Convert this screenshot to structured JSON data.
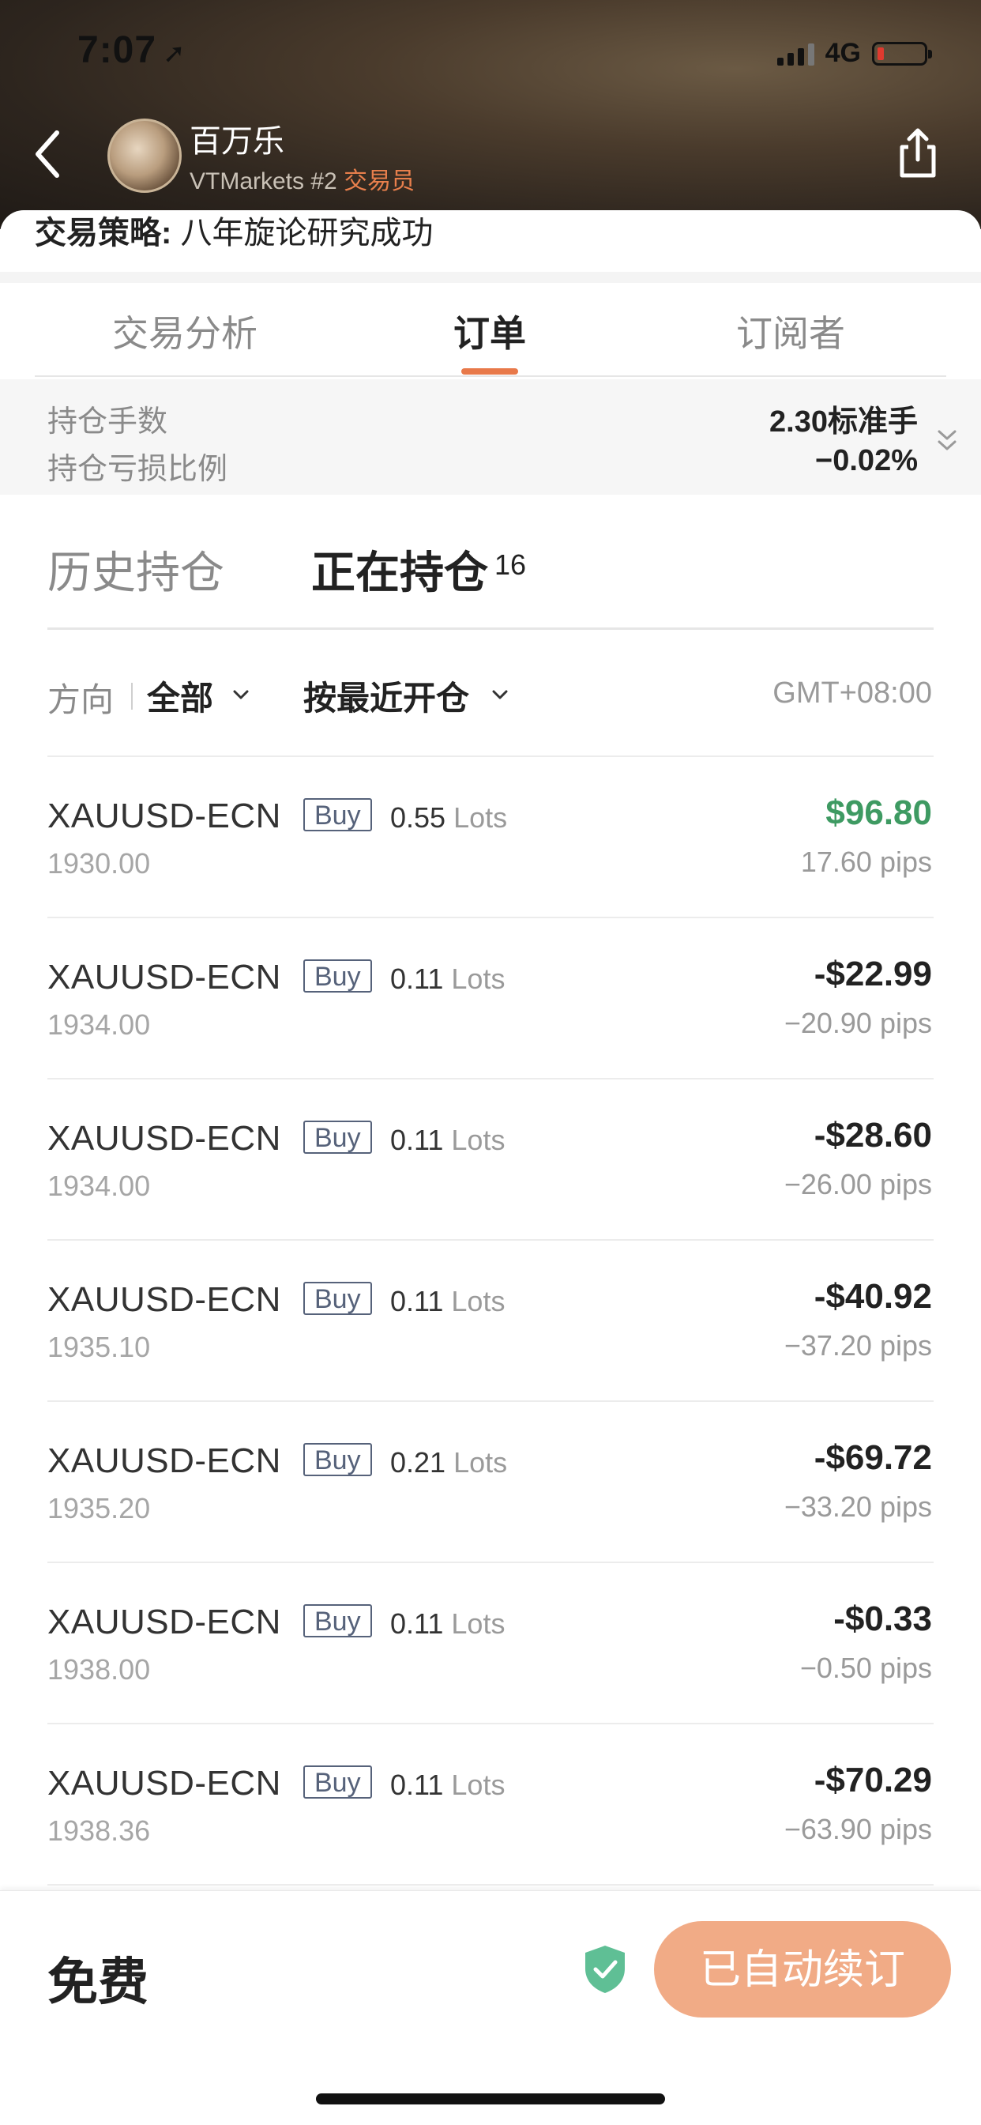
{
  "status_bar": {
    "time": "7:07",
    "network": "4G"
  },
  "header": {
    "trader_name": "百万乐",
    "broker_rank": "VTMarkets #2",
    "role": "交易员"
  },
  "strategy": {
    "label": "交易策略:",
    "text": "八年旋论研究成功"
  },
  "tabs": [
    {
      "label": "交易分析",
      "active": false
    },
    {
      "label": "订单",
      "active": true
    },
    {
      "label": "订阅者",
      "active": false
    }
  ],
  "summary": {
    "lots_label": "持仓手数",
    "lots_value": "2.30标准手",
    "pnl_ratio_label": "持仓亏损比例",
    "pnl_ratio_value": "−0.02%"
  },
  "position_tabs": {
    "history_label": "历史持仓",
    "open_label": "正在持仓",
    "open_count": "16"
  },
  "filters": {
    "direction_label": "方向",
    "direction_value": "全部",
    "sort_value": "按最近开仓",
    "timezone": "GMT+08:00"
  },
  "orders": [
    {
      "symbol": "XAUUSD-ECN",
      "side": "Buy",
      "lots": "0.55",
      "lots_unit": "Lots",
      "open_price": "1930.00",
      "pnl": "$96.80",
      "pips": "17.60 pips",
      "positive": true
    },
    {
      "symbol": "XAUUSD-ECN",
      "side": "Buy",
      "lots": "0.11",
      "lots_unit": "Lots",
      "open_price": "1934.00",
      "pnl": "-$22.99",
      "pips": "−20.90 pips",
      "positive": false
    },
    {
      "symbol": "XAUUSD-ECN",
      "side": "Buy",
      "lots": "0.11",
      "lots_unit": "Lots",
      "open_price": "1934.00",
      "pnl": "-$28.60",
      "pips": "−26.00 pips",
      "positive": false
    },
    {
      "symbol": "XAUUSD-ECN",
      "side": "Buy",
      "lots": "0.11",
      "lots_unit": "Lots",
      "open_price": "1935.10",
      "pnl": "-$40.92",
      "pips": "−37.20 pips",
      "positive": false
    },
    {
      "symbol": "XAUUSD-ECN",
      "side": "Buy",
      "lots": "0.21",
      "lots_unit": "Lots",
      "open_price": "1935.20",
      "pnl": "-$69.72",
      "pips": "−33.20 pips",
      "positive": false
    },
    {
      "symbol": "XAUUSD-ECN",
      "side": "Buy",
      "lots": "0.11",
      "lots_unit": "Lots",
      "open_price": "1938.00",
      "pnl": "-$0.33",
      "pips": "−0.50 pips",
      "positive": false
    },
    {
      "symbol": "XAUUSD-ECN",
      "side": "Buy",
      "lots": "0.11",
      "lots_unit": "Lots",
      "open_price": "1938.36",
      "pnl": "-$70.29",
      "pips": "−63.90 pips",
      "positive": false
    }
  ],
  "bottom_bar": {
    "price_label": "免费",
    "button_label": "已自动续订"
  },
  "colors": {
    "accent": "#e8794a",
    "positive": "#3e9a62",
    "button": "#f1ab86",
    "side_badge": "#56627a"
  },
  "icons": [
    "navigation-arrow-icon",
    "signal-icon",
    "battery-icon",
    "back-icon",
    "share-icon",
    "expand-icon",
    "chevron-down-icon",
    "shield-check-icon"
  ]
}
